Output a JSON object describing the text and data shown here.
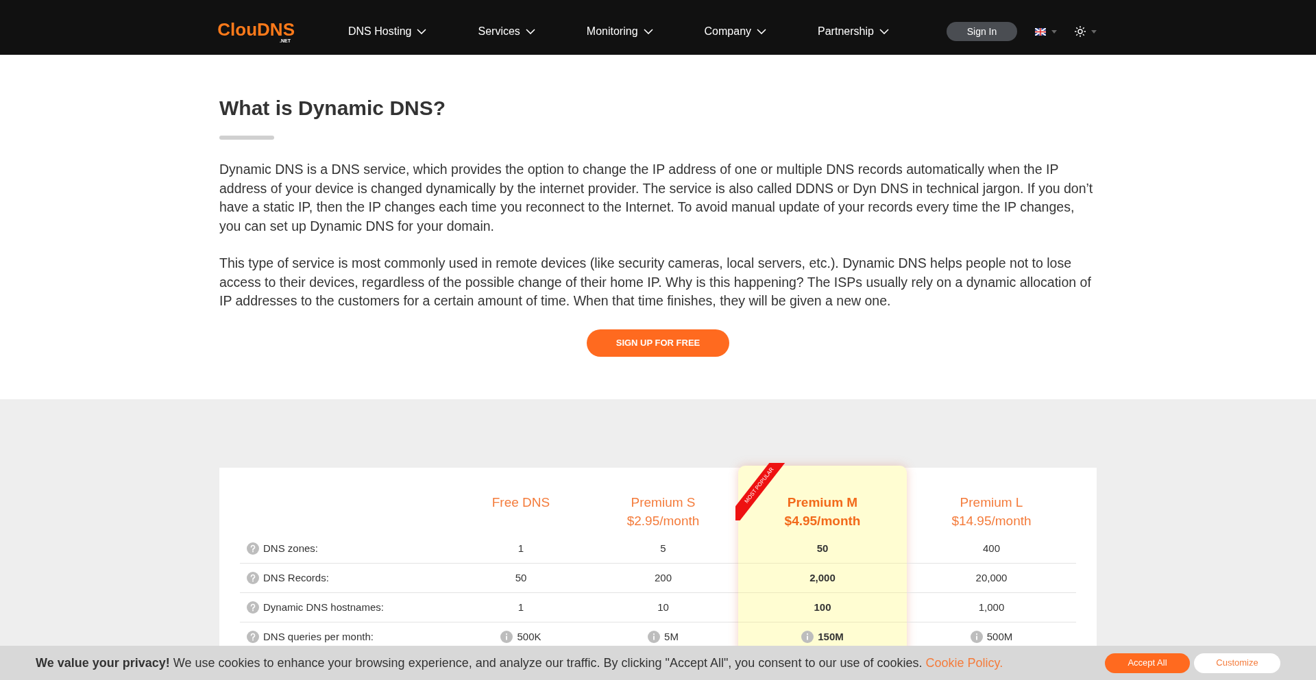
{
  "header": {
    "logo": {
      "name": "ClouDNS",
      "suffix": ".NET"
    },
    "menu": [
      {
        "label": "DNS Hosting"
      },
      {
        "label": "Services"
      },
      {
        "label": "Monitoring"
      },
      {
        "label": "Company"
      },
      {
        "label": "Partnership"
      }
    ],
    "sign_in": "Sign In"
  },
  "intro": {
    "title": "What is Dynamic DNS?",
    "paragraphs": [
      "Dynamic DNS is a DNS service, which provides the option to change the IP address of one or multiple DNS records automatically when the IP address of your device is changed dynamically by the internet provider. The service is also called DDNS or Dyn DNS in technical jargon. If you don’t have a static IP, then the IP changes each time you reconnect to the Internet. To avoid manual update of your records every time the IP changes, you can set up Dynamic DNS for your domain.",
      "This type of service is most commonly used in remote devices (like security cameras, local servers, etc.). Dynamic DNS helps people not to lose access to their devices, regardless of the possible change of their home IP. Why is this happening? The ISPs usually rely on a dynamic allocation of IP addresses to the customers for a certain amount of time. When that time finishes, they will be given a new one."
    ],
    "cta": "SIGN UP FOR FREE"
  },
  "pricing": {
    "plans": [
      {
        "name": "Free DNS",
        "featured": false
      },
      {
        "name": "Premium S",
        "price": "$2.95/month",
        "featured": false
      },
      {
        "name": "Premium M",
        "price": "$4.95/month",
        "featured": true,
        "badge": "MOST POPULAR"
      },
      {
        "name": "Premium L",
        "price": "$14.95/month",
        "featured": false
      }
    ],
    "rows": [
      {
        "label": "DNS zones:",
        "values": [
          {
            "text": "1",
            "info": false
          },
          {
            "text": "5",
            "info": false
          },
          {
            "text": "50",
            "info": false
          },
          {
            "text": "400",
            "info": false
          }
        ]
      },
      {
        "label": "DNS Records:",
        "values": [
          {
            "text": "50",
            "info": false
          },
          {
            "text": "200",
            "info": false
          },
          {
            "text": "2,000",
            "info": false
          },
          {
            "text": "20,000",
            "info": false
          }
        ]
      },
      {
        "label": "Dynamic DNS hostnames:",
        "values": [
          {
            "text": "1",
            "info": false
          },
          {
            "text": "10",
            "info": false
          },
          {
            "text": "100",
            "info": false
          },
          {
            "text": "1,000",
            "info": false
          }
        ]
      },
      {
        "label": "DNS queries per month:",
        "values": [
          {
            "text": "500K",
            "info": true
          },
          {
            "text": "5M",
            "info": true
          },
          {
            "text": "150M",
            "info": true
          },
          {
            "text": "500M",
            "info": true
          }
        ]
      }
    ]
  },
  "cookie_bar": {
    "lead": "We value your privacy!",
    "text": "We use cookies to enhance your browsing experience, and analyze our traffic. By clicking \"Accept All\", you consent to our use of cookies.",
    "link": "Cookie Policy.",
    "buttons": [
      "Accept All",
      "Customize"
    ]
  }
}
